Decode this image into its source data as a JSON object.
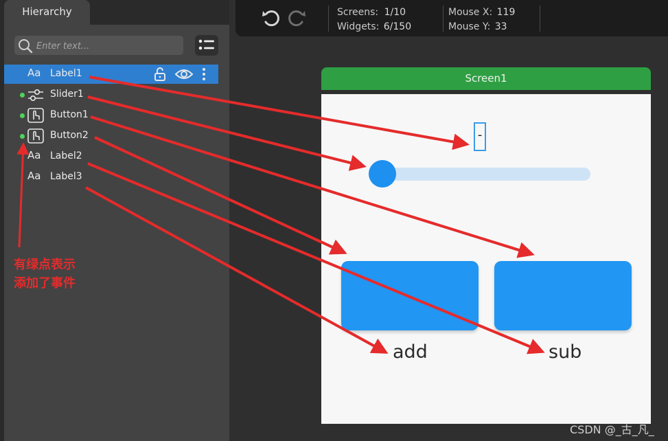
{
  "hierarchy": {
    "tab_label": "Hierarchy",
    "search_placeholder": "Enter text...",
    "items": [
      {
        "name": "Label1",
        "type": "label",
        "type_icon": "Aa",
        "has_event": false,
        "selected": true
      },
      {
        "name": "Slider1",
        "type": "slider",
        "type_icon": "slider-icon",
        "has_event": true,
        "selected": false
      },
      {
        "name": "Button1",
        "type": "button",
        "type_icon": "hand-pointer-icon",
        "has_event": true,
        "selected": false
      },
      {
        "name": "Button2",
        "type": "button",
        "type_icon": "hand-pointer-icon",
        "has_event": true,
        "selected": false
      },
      {
        "name": "Label2",
        "type": "label",
        "type_icon": "Aa",
        "has_event": false,
        "selected": false
      },
      {
        "name": "Label3",
        "type": "label",
        "type_icon": "Aa",
        "has_event": false,
        "selected": false
      }
    ]
  },
  "annotation": {
    "line1": "有绿点表示",
    "line2": "添加了事件",
    "color": "#e52b2b"
  },
  "toolbar": {
    "screens_label": "Screens:",
    "screens_value": "1/10",
    "widgets_label": "Widgets:",
    "widgets_value": "6/150",
    "mouse_x_label": "Mouse X:",
    "mouse_x_value": "119",
    "mouse_y_label": "Mouse Y:",
    "mouse_y_value": "33"
  },
  "screen": {
    "title": "Screen1",
    "title_color": "#2ea043",
    "label1_text": "-",
    "slider_value": 0,
    "button1_label": "add",
    "button2_label": "sub",
    "button_color": "#2196f3"
  },
  "watermark": "CSDN @_古_凡_",
  "colors": {
    "selected_row": "#2f7fd0",
    "event_dot": "#4ed35a",
    "arrow": "#e52b2b"
  }
}
